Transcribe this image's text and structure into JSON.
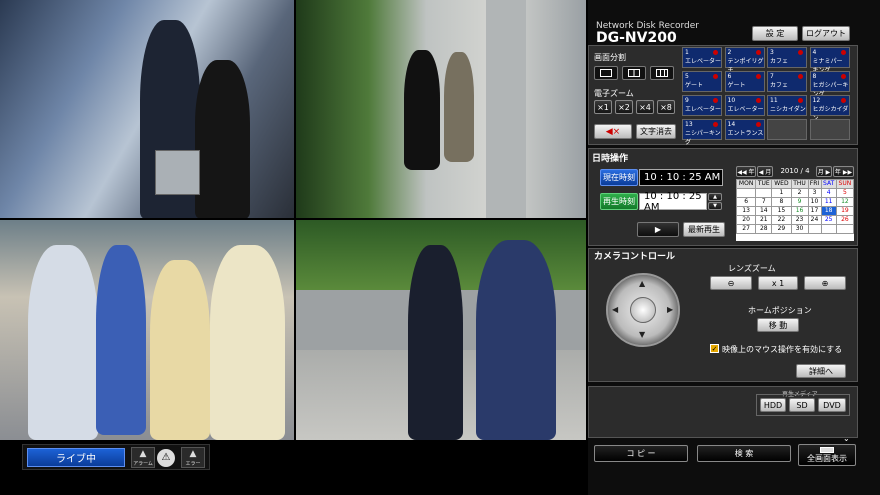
{
  "app": {
    "subtitle": "Network Disk Recorder",
    "model": "DG-NV200"
  },
  "top_buttons": {
    "settings": "設 定",
    "logout": "ログアウト"
  },
  "screen_split": {
    "label": "画面分割"
  },
  "digital_zoom": {
    "label": "電子ズーム",
    "options": [
      "×1",
      "×2",
      "×4",
      "×8"
    ]
  },
  "text_clear": "文字消去",
  "cameras": [
    {
      "num": "1",
      "name": "エレベーター"
    },
    {
      "num": "2",
      "name": "テンポイリグチ"
    },
    {
      "num": "3",
      "name": "カフェ"
    },
    {
      "num": "4",
      "name": "ミナミパーキング"
    },
    {
      "num": "5",
      "name": "ゲート"
    },
    {
      "num": "6",
      "name": "ゲート"
    },
    {
      "num": "7",
      "name": "カフェ"
    },
    {
      "num": "8",
      "name": "ヒガシパーキング"
    },
    {
      "num": "9",
      "name": "エレベーター"
    },
    {
      "num": "10",
      "name": "エレベーター"
    },
    {
      "num": "11",
      "name": "ニシカイダン"
    },
    {
      "num": "12",
      "name": "ヒガシカイダン"
    },
    {
      "num": "13",
      "name": "ニシパーキング"
    },
    {
      "num": "14",
      "name": "エントランス"
    },
    {
      "num": "",
      "name": ""
    },
    {
      "num": "",
      "name": ""
    }
  ],
  "datetime": {
    "label": "日時操作",
    "current_label": "現在時刻",
    "current_time": "10 : 10 : 25 AM",
    "playback_label": "再生時刻",
    "playback_time": "10 : 10 : 25 AM",
    "play": "▶",
    "latest": "最新再生"
  },
  "calendar": {
    "prev_year": "◀◀ 年",
    "prev_month": "◀ 月",
    "month": "2010 / 4",
    "next_month": "月 ▶",
    "next_year": "年 ▶▶",
    "days": [
      "MON",
      "TUE",
      "WED",
      "THU",
      "FRI",
      "SAT",
      "SUN"
    ],
    "weeks": [
      [
        "",
        "",
        "1",
        "2",
        "3",
        "4",
        "5"
      ],
      [
        "6",
        "7",
        "8",
        "9",
        "10",
        "11",
        "12"
      ],
      [
        "13",
        "14",
        "15",
        "16",
        "17",
        "18",
        "19"
      ],
      [
        "20",
        "21",
        "22",
        "23",
        "24",
        "25",
        "26"
      ],
      [
        "27",
        "28",
        "29",
        "30",
        "",
        "",
        ""
      ]
    ]
  },
  "camera_control": {
    "label": "カメラコントロール",
    "lens_zoom": "レンズズーム",
    "zoom_value": "x 1",
    "home_position": "ホームポジション",
    "move": "移 動",
    "mouse_enable": "映像上のマウス操作を有効にする",
    "detail": "詳細へ"
  },
  "media": {
    "label": "再生メディア",
    "hdd": "HDD",
    "sd": "SD",
    "dvd": "DVD"
  },
  "bottom": {
    "copy": "コ ピ ー",
    "search": "検 索",
    "fullscreen": "全画面表示"
  },
  "live": {
    "label": "ライブ中",
    "alarm": "アラーム",
    "error": "エラー"
  },
  "colors": {
    "accent_blue": "#1d62d6",
    "camera_tile": "#0f2a6e",
    "selected_day": "#1d62d6",
    "panel_bg": "#2c2c2c"
  }
}
